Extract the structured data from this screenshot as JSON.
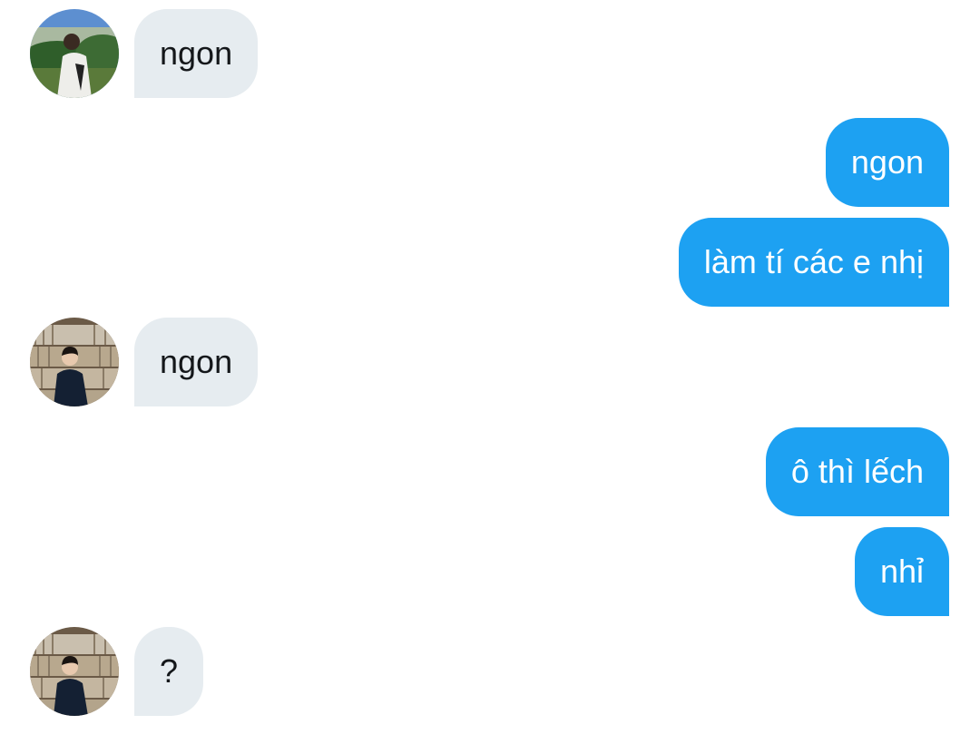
{
  "conversation": {
    "messages": [
      {
        "sender": "other",
        "avatar": "avatar-landscape",
        "text": "ngon"
      },
      {
        "sender": "self",
        "text": "ngon"
      },
      {
        "sender": "self",
        "text": "làm tí các e nhị"
      },
      {
        "sender": "other",
        "avatar": "avatar-bookshelf",
        "text": "ngon"
      },
      {
        "sender": "self",
        "text": "ô thì lếch"
      },
      {
        "sender": "self",
        "text": "nhỉ"
      },
      {
        "sender": "other",
        "avatar": "avatar-bookshelf",
        "text": "?"
      }
    ]
  },
  "colors": {
    "outgoing_bubble": "#1da1f2",
    "incoming_bubble": "#e6ecf0",
    "incoming_text": "#14171a",
    "outgoing_text": "#ffffff",
    "background": "#ffffff"
  }
}
